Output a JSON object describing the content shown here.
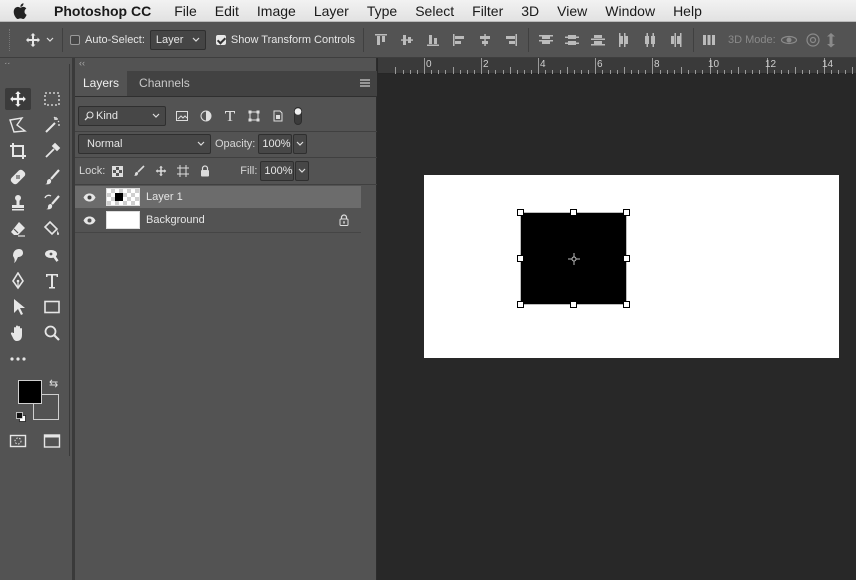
{
  "menubar": {
    "app_name": "Photoshop CC",
    "items": [
      "File",
      "Edit",
      "Image",
      "Layer",
      "Type",
      "Select",
      "Filter",
      "3D",
      "View",
      "Window",
      "Help"
    ]
  },
  "options_bar": {
    "auto_select_label": "Auto-Select:",
    "auto_select_checked": false,
    "auto_select_target": "Layer",
    "show_transform_label": "Show Transform Controls",
    "show_transform_checked": true,
    "mode_3d_label": "3D Mode:"
  },
  "layers_panel": {
    "tabs": [
      "Layers",
      "Channels"
    ],
    "active_tab": "Layers",
    "filter_kind": "Kind",
    "blend_mode": "Normal",
    "opacity_label": "Opacity:",
    "opacity_value": "100%",
    "lock_label": "Lock:",
    "fill_label": "Fill:",
    "fill_value": "100%",
    "layers": [
      {
        "name": "Layer 1",
        "visible": true,
        "selected": true,
        "locked": false
      },
      {
        "name": "Background",
        "visible": true,
        "selected": false,
        "locked": true
      }
    ]
  },
  "ruler": {
    "ticks": [
      "0",
      "2",
      "4",
      "6",
      "8",
      "10",
      "12",
      "14"
    ]
  },
  "colors": {
    "foreground": "#000000",
    "background": "#ffffff",
    "ui_panel": "#535353",
    "workspace": "#282828"
  }
}
